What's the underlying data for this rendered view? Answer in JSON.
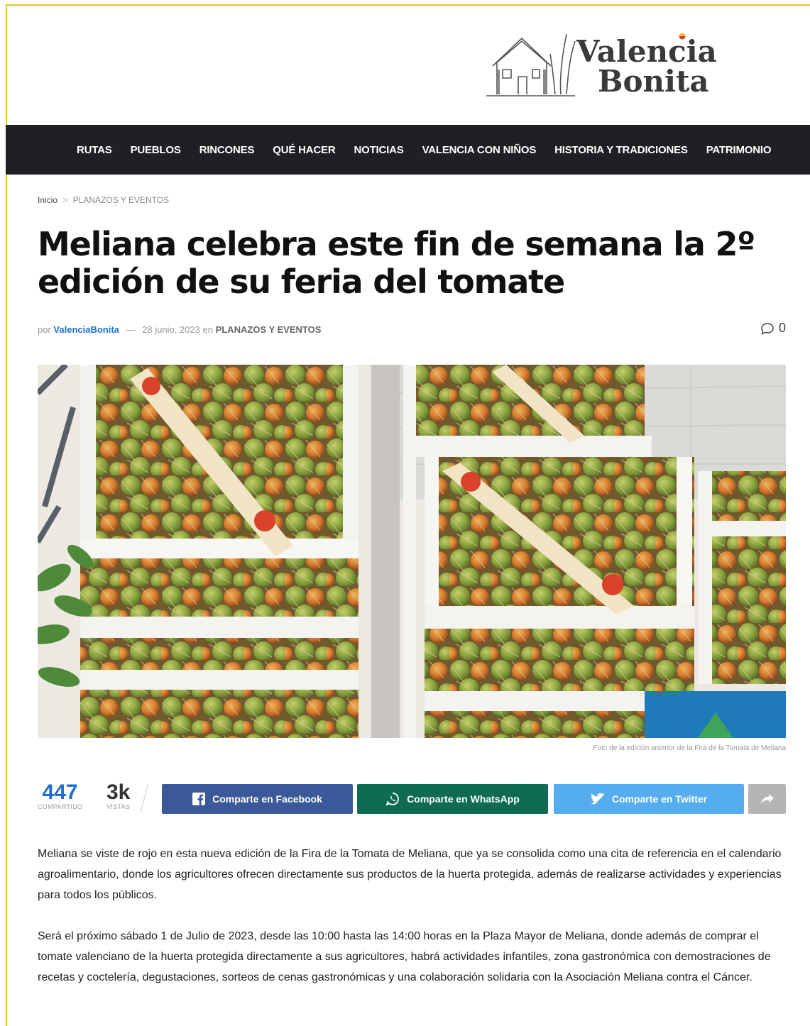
{
  "site": {
    "logo_line1": "Valencia",
    "logo_line2": "Bonita"
  },
  "nav": {
    "items": [
      "RUTAS",
      "PUEBLOS",
      "RINCONES",
      "QUÉ HACER",
      "NOTICIAS",
      "VALENCIA CON NIÑOS",
      "HISTORIA Y TRADICIONES",
      "PATRIMONIO"
    ]
  },
  "breadcrumb": {
    "home": "Inicio",
    "separator": ">",
    "current": "PLANAZOS Y EVENTOS"
  },
  "article": {
    "title": "Meliana celebra este fin de semana la 2º edición de su feria del tomate",
    "by": "por",
    "author": "ValenciaBonita",
    "dash": "—",
    "date": "28 junio, 2023",
    "in": "en",
    "category": "PLANAZOS Y EVENTOS",
    "comments_count": "0",
    "image_caption": "Foto de la edición anterior de la Fira de la Tomata de Meliana",
    "paragraphs": [
      "Meliana se viste de rojo en esta nueva edición de la Fira de la Tomata de Meliana, que ya se consolida como una cita de referencia en el calendario agroalimentario, donde los agricultores ofrecen directamente sus productos de la huerta protegida, además de realizarse actividades y experiencias para todos los públicos.",
      "Será el próximo sábado 1 de Julio de 2023, desde las 10:00 hasta las 14:00 horas en la Plaza Mayor de Meliana, donde además de comprar el tomate valenciano de la huerta protegida directamente a sus agricultores, habrá actividades infantiles, zona gastronómica con demostraciones de recetas y coctelería, degustaciones, sorteos de cenas gastronómicas y una colaboración solidaria con la Asociación Meliana contra el Cáncer."
    ]
  },
  "share": {
    "shares_count": "447",
    "shares_label": "COMPARTIDO",
    "views_count": "3k",
    "views_label": "VISTAS",
    "facebook_label": "Comparte en Facebook",
    "whatsapp_label": "Comparte en WhatsApp",
    "twitter_label": "Comparte en Twitter"
  },
  "colors": {
    "nav_bg": "#1f1f24",
    "accent_blue": "#1e6fd1",
    "facebook": "#3b5998",
    "whatsapp": "#0f6b52",
    "twitter": "#55acee",
    "more": "#b5b5b5"
  },
  "icons": [
    "house-sketch-logo-icon",
    "comment-bubble-icon",
    "facebook-icon",
    "whatsapp-icon",
    "twitter-icon",
    "share-arrow-icon"
  ]
}
